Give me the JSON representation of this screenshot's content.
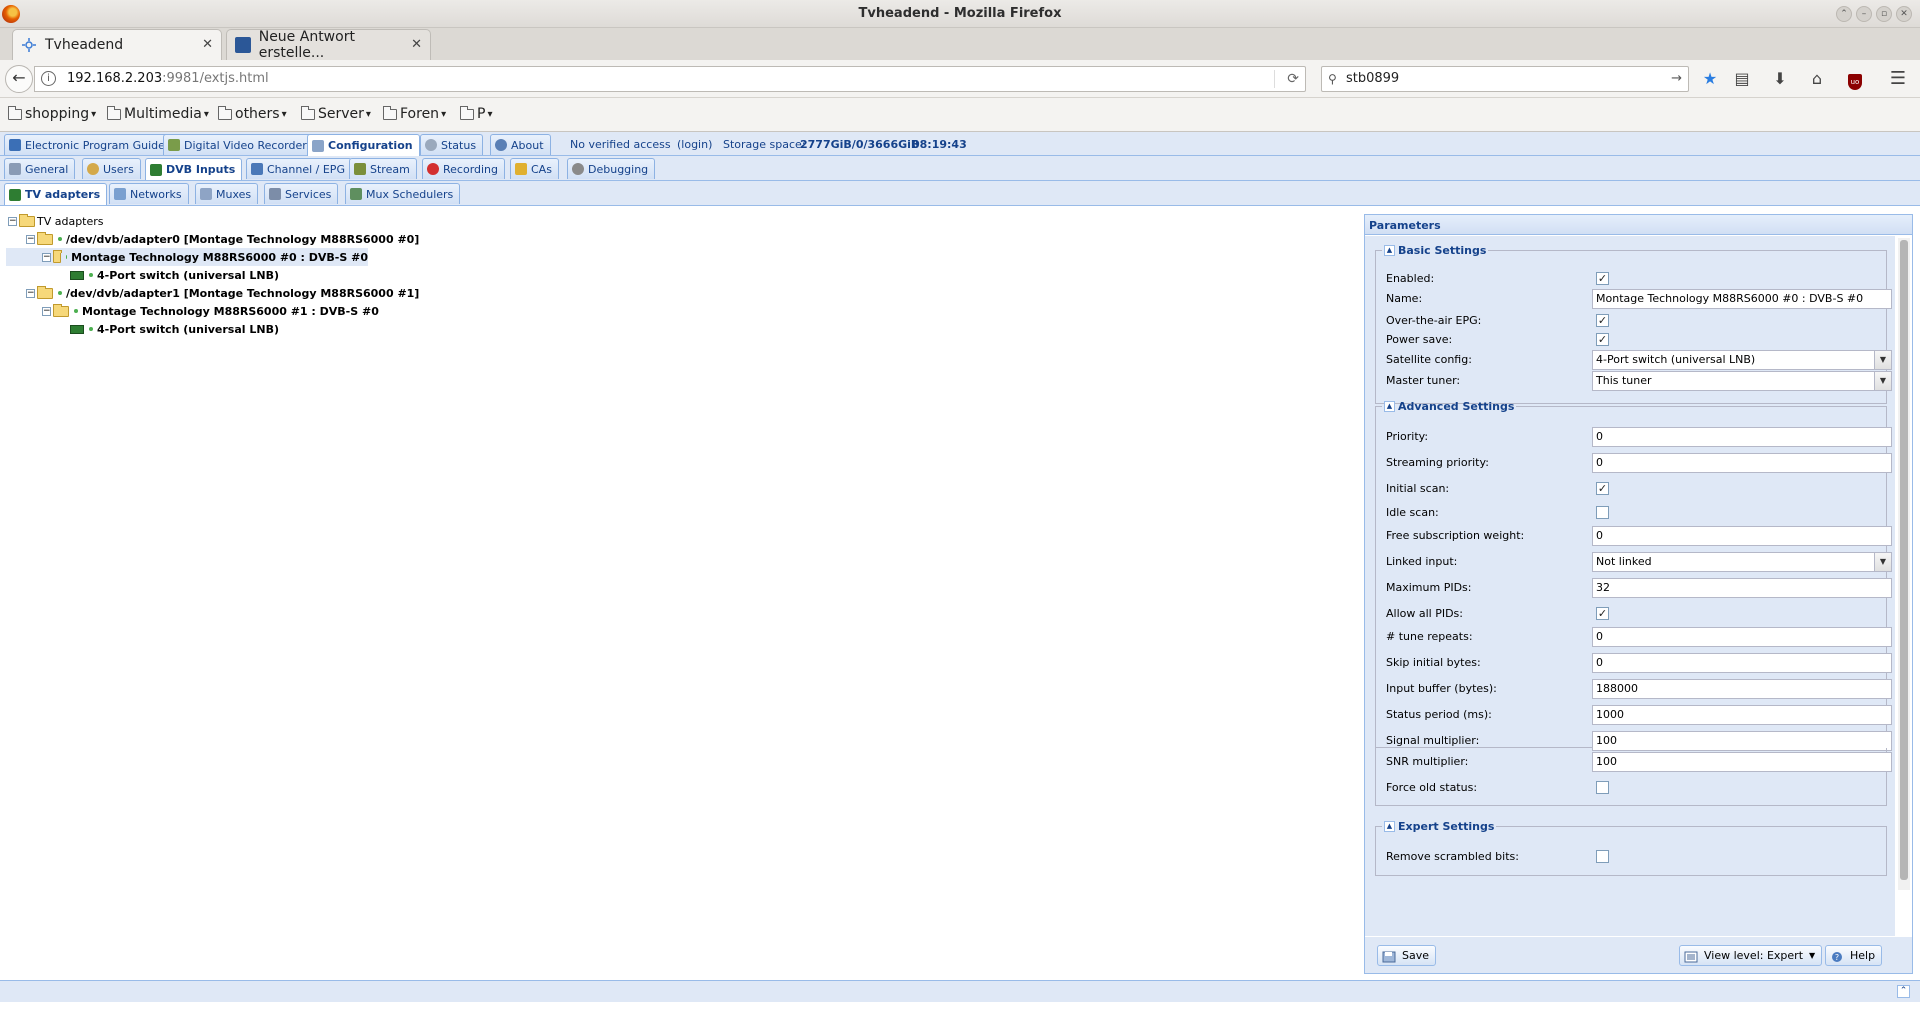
{
  "window": {
    "title": "Tvheadend - Mozilla Firefox"
  },
  "browser_tabs": [
    {
      "title": "Tvheadend",
      "active": true
    },
    {
      "title": "Neue Antwort erstelle...",
      "active": false
    }
  ],
  "new_tab": "+",
  "address": {
    "host": "192.168.2.203",
    "path": ":9981/extjs.html"
  },
  "search": {
    "value": "stb0899"
  },
  "bookmarks": [
    "shopping",
    "Multimedia",
    "others",
    "Server",
    "Foren",
    "P"
  ],
  "main_tabs": [
    {
      "label": "Electronic Program Guide"
    },
    {
      "label": "Digital Video Recorder"
    },
    {
      "label": "Configuration",
      "selected": true
    },
    {
      "label": "Status"
    },
    {
      "label": "About"
    }
  ],
  "status": {
    "access": "No verified access",
    "login": "(login)",
    "storage_label": "Storage space:",
    "storage_value": "2777GiB/0/3666GiB",
    "time": "08:19:43"
  },
  "config_tabs": [
    {
      "label": "General"
    },
    {
      "label": "Users"
    },
    {
      "label": "DVB Inputs",
      "selected": true
    },
    {
      "label": "Channel / EPG"
    },
    {
      "label": "Stream"
    },
    {
      "label": "Recording"
    },
    {
      "label": "CAs"
    },
    {
      "label": "Debugging"
    }
  ],
  "dvb_tabs": [
    {
      "label": "TV adapters",
      "selected": true
    },
    {
      "label": "Networks"
    },
    {
      "label": "Muxes"
    },
    {
      "label": "Services"
    },
    {
      "label": "Mux Schedulers"
    }
  ],
  "tree": {
    "root": "TV adapters",
    "nodes": [
      {
        "label": "/dev/dvb/adapter0 [Montage Technology M88RS6000 #0]"
      },
      {
        "label": "Montage Technology M88RS6000 #0 : DVB-S #0",
        "selected": true
      },
      {
        "label": "4-Port switch (universal LNB)"
      },
      {
        "label": "/dev/dvb/adapter1 [Montage Technology M88RS6000 #1]"
      },
      {
        "label": "Montage Technology M88RS6000 #1 : DVB-S #0"
      },
      {
        "label": "4-Port switch (universal LNB)"
      }
    ]
  },
  "params": {
    "title": "Parameters",
    "basic": {
      "legend": "Basic Settings",
      "enabled": {
        "label": "Enabled:",
        "checked": true
      },
      "name": {
        "label": "Name:",
        "value": "Montage Technology M88RS6000 #0 : DVB-S #0"
      },
      "ota_epg": {
        "label": "Over-the-air EPG:",
        "checked": true
      },
      "power_save": {
        "label": "Power save:",
        "checked": true
      },
      "sat_config": {
        "label": "Satellite config:",
        "value": "4-Port switch (universal LNB)"
      },
      "master_tuner": {
        "label": "Master tuner:",
        "value": "This tuner"
      }
    },
    "advanced": {
      "legend": "Advanced Settings",
      "priority": {
        "label": "Priority:",
        "value": "0"
      },
      "streaming_priority": {
        "label": "Streaming priority:",
        "value": "0"
      },
      "initial_scan": {
        "label": "Initial scan:",
        "checked": true
      },
      "idle_scan": {
        "label": "Idle scan:",
        "checked": false
      },
      "free_sub_weight": {
        "label": "Free subscription weight:",
        "value": "0"
      },
      "linked_input": {
        "label": "Linked input:",
        "value": "Not linked"
      },
      "max_pids": {
        "label": "Maximum PIDs:",
        "value": "32"
      },
      "allow_all_pids": {
        "label": "Allow all PIDs:",
        "checked": true
      },
      "tune_repeats": {
        "label": "# tune repeats:",
        "value": "0"
      },
      "skip_initial_bytes": {
        "label": "Skip initial bytes:",
        "value": "0"
      },
      "input_buffer": {
        "label": "Input buffer (bytes):",
        "value": "188000"
      },
      "status_period": {
        "label": "Status period (ms):",
        "value": "1000"
      },
      "signal_multiplier": {
        "label": "Signal multiplier:",
        "value": "100"
      },
      "snr_multiplier": {
        "label": "SNR multiplier:",
        "value": "100"
      },
      "force_old_status": {
        "label": "Force old status:",
        "checked": false
      }
    },
    "expert": {
      "legend": "Expert Settings",
      "remove_scrambled": {
        "label": "Remove scrambled bits:",
        "checked": false
      }
    },
    "buttons": {
      "save": "Save",
      "view_level": "View level: Expert",
      "help": "Help"
    }
  },
  "check_glyph": "✓"
}
